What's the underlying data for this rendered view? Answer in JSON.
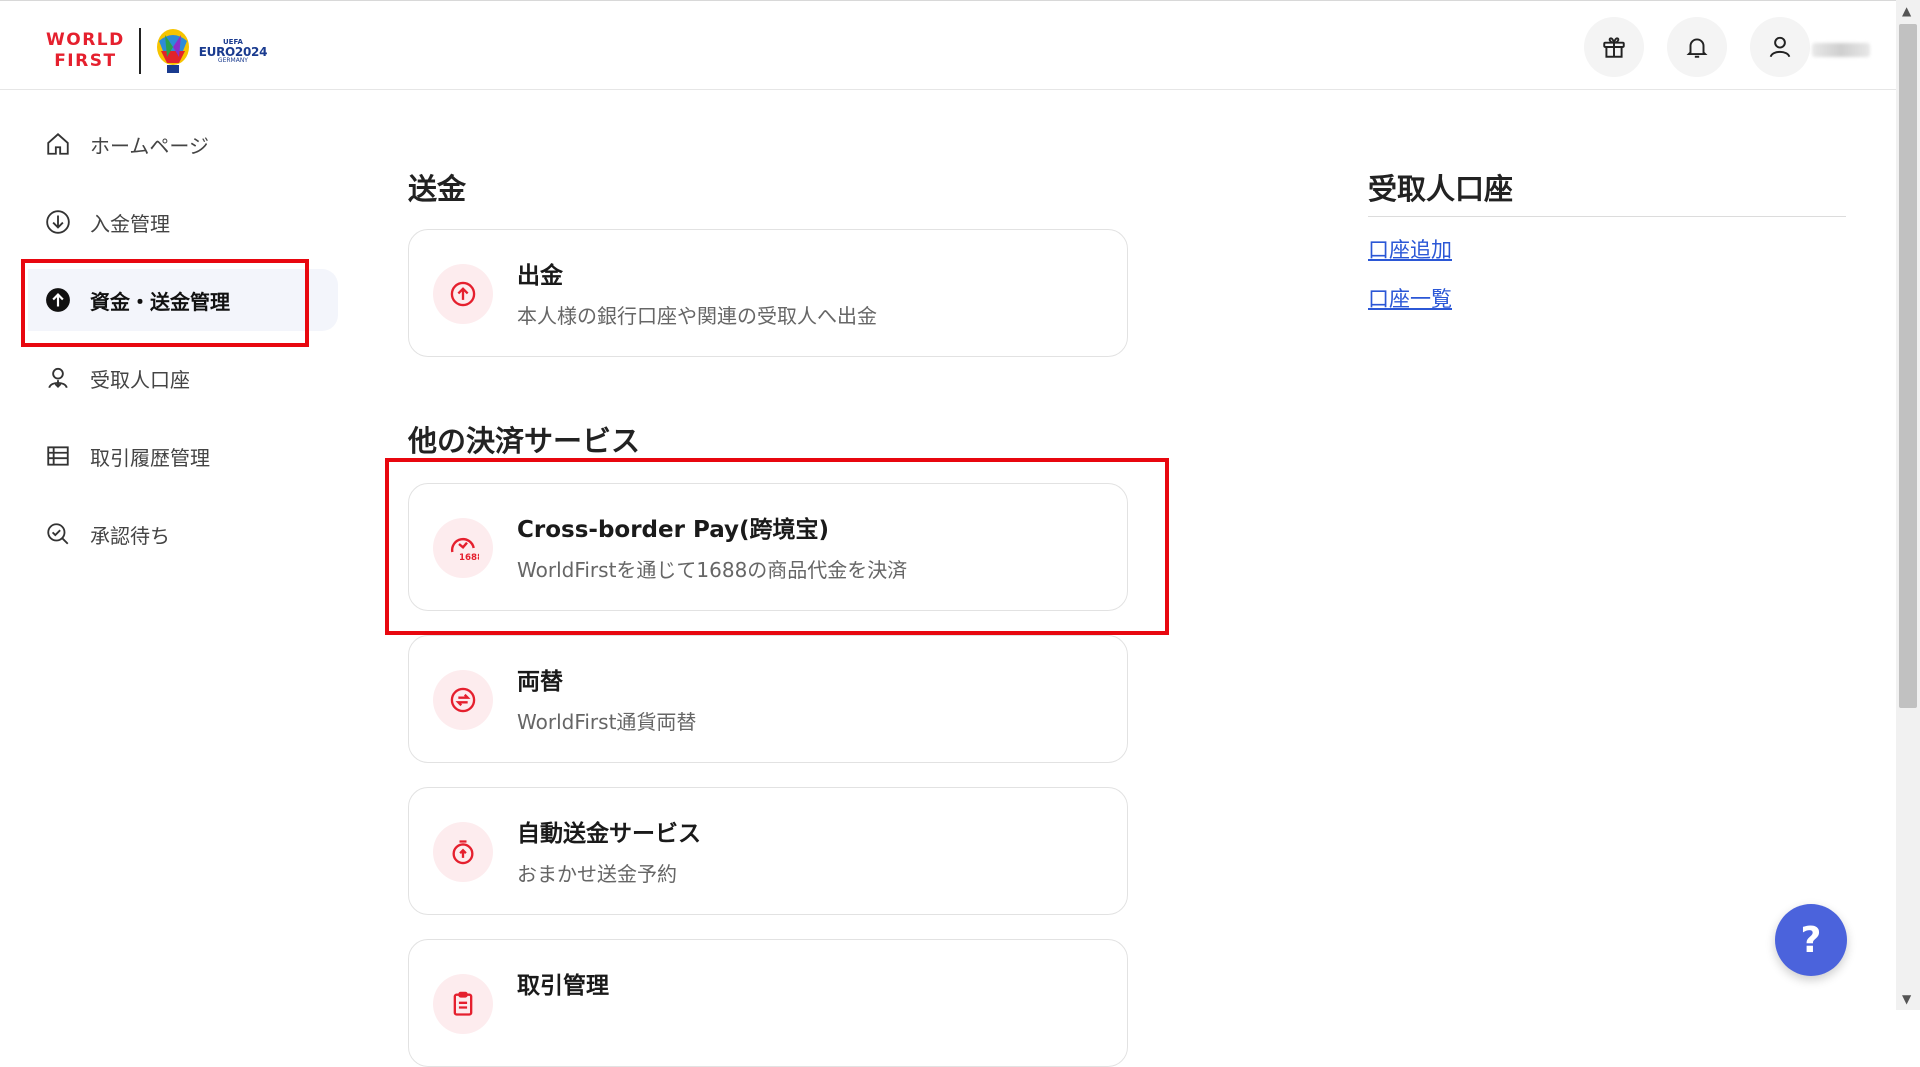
{
  "header": {
    "logo_line1": "WORLD",
    "logo_line2": "FIRST",
    "euro_top": "UEFA",
    "euro_main": "EURO2024",
    "euro_sub": "GERMANY",
    "icons": [
      "gift-icon",
      "bell-icon",
      "user-icon"
    ]
  },
  "sidebar": {
    "items": [
      {
        "label": "ホームページ",
        "icon": "home-icon"
      },
      {
        "label": "入金管理",
        "icon": "download-circle-icon"
      },
      {
        "label": "資金・送金管理",
        "icon": "upload-circle-icon",
        "active": true
      },
      {
        "label": "受取人口座",
        "icon": "recipient-icon"
      },
      {
        "label": "取引履歴管理",
        "icon": "table-icon"
      },
      {
        "label": "承認待ち",
        "icon": "search-check-icon"
      }
    ]
  },
  "main": {
    "section1_title": "送金",
    "section2_title": "他の決済サービス",
    "cards": [
      {
        "title": "出金",
        "desc": "本人様の銀行口座や関連の受取人へ出金",
        "icon": "withdraw-icon"
      },
      {
        "title": "Cross-border Pay(跨境宝)",
        "desc": "WorldFirstを通じて1688の商品代金を決済",
        "icon": "crossborder-1688-icon",
        "icon_badge": "1688"
      },
      {
        "title": "両替",
        "desc": "WorldFirst通貨両替",
        "icon": "exchange-icon"
      },
      {
        "title": "自動送金サービス",
        "desc": "おまかせ送金予約",
        "icon": "timer-icon"
      },
      {
        "title": "取引管理",
        "desc": "",
        "icon": "clipboard-icon"
      }
    ]
  },
  "right_panel": {
    "title": "受取人口座",
    "links": [
      "口座追加",
      "口座一覧"
    ]
  },
  "help_label": "?",
  "colors": {
    "accent_red": "#e5202e",
    "highlight_box": "#e8070f",
    "link": "#2b57d6",
    "help_button": "#4b63dc"
  }
}
